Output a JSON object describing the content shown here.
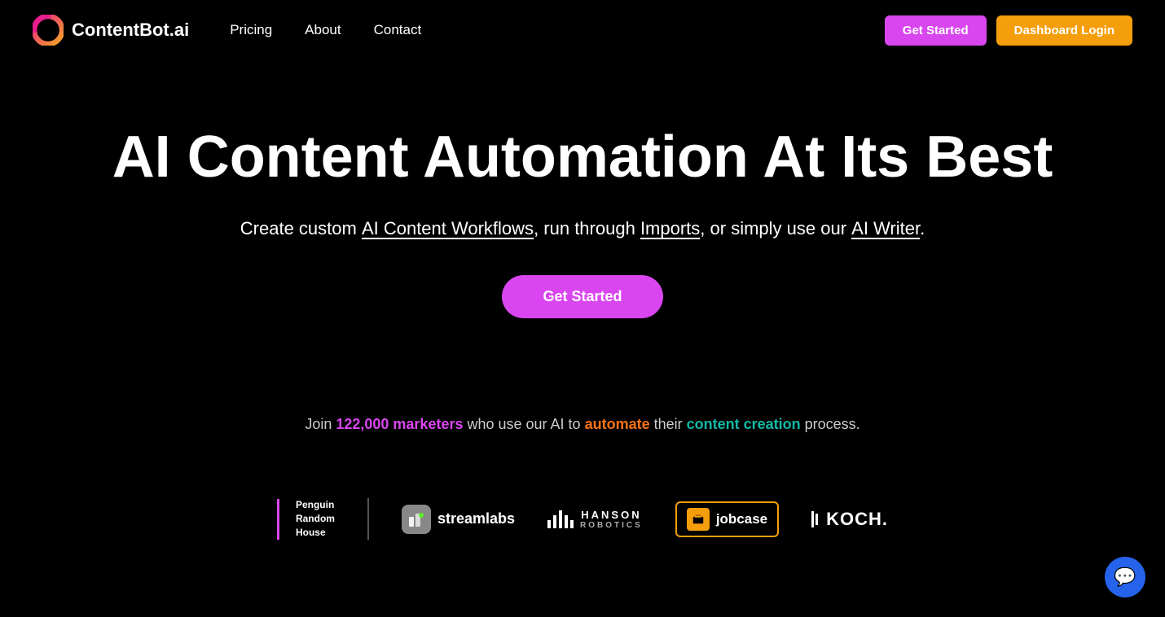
{
  "nav": {
    "logo_text": "ContentBot.ai",
    "links": [
      {
        "label": "Pricing",
        "href": "#"
      },
      {
        "label": "About",
        "href": "#"
      },
      {
        "label": "Contact",
        "href": "#"
      }
    ],
    "btn_get_started": "Get Started",
    "btn_dashboard_login": "Dashboard Login"
  },
  "hero": {
    "title": "AI Content Automation At Its Best",
    "subtitle_before": "Create custom ",
    "subtitle_link1": "AI Content Workflows",
    "subtitle_middle": ", run through ",
    "subtitle_link2": "Imports",
    "subtitle_after_middle": ", or simply use our ",
    "subtitle_link3": "AI Writer",
    "subtitle_end": ".",
    "btn_label": "Get Started"
  },
  "social_proof": {
    "text_before": "Join ",
    "highlight1": "122,000 marketers",
    "text_middle": " who use our AI to ",
    "highlight2": "automate",
    "text_after": " their ",
    "highlight3": "content creation",
    "text_end": " process."
  },
  "logos": [
    {
      "id": "penguin",
      "line1": "Penguin",
      "line2": "Random",
      "line3": "House"
    },
    {
      "id": "streamlabs",
      "label": "streamlabs"
    },
    {
      "id": "hanson",
      "line1": "HANSON",
      "line2": "ROBOTICS"
    },
    {
      "id": "jobcase",
      "label": "jobcase"
    },
    {
      "id": "koch",
      "label": "KOCH."
    }
  ]
}
